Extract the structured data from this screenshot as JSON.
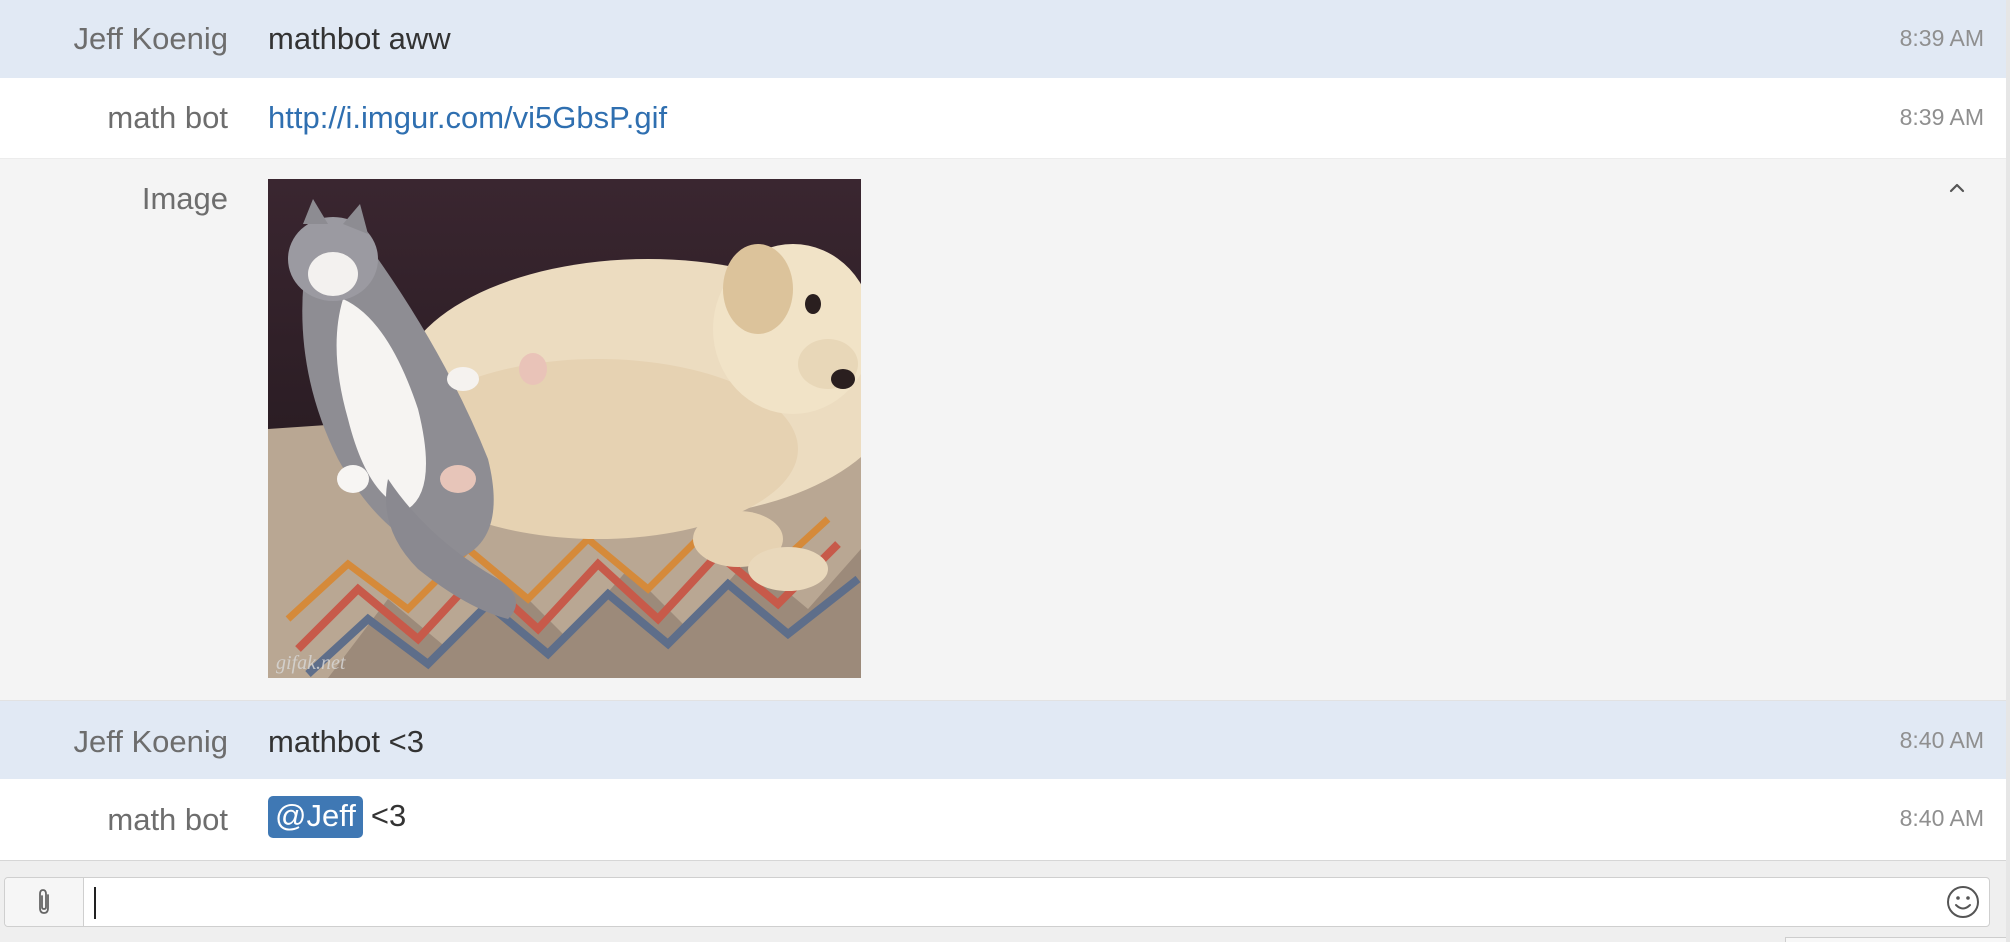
{
  "messages": [
    {
      "sender": "Jeff Koenig",
      "text": "mathbot aww",
      "time": "8:39 AM"
    },
    {
      "sender": "math bot",
      "link": "http://i.imgur.com/vi5GbsP.gif",
      "time": "8:39 AM"
    },
    {
      "sender": "Image",
      "watermark": "gifak.net"
    },
    {
      "sender": "Jeff Koenig",
      "text": "mathbot <3",
      "time": "8:40 AM"
    },
    {
      "sender": "math bot",
      "mention": "@Jeff",
      "text": "<3",
      "time": "8:40 AM"
    }
  ],
  "composer": {
    "value": "",
    "placeholder": ""
  },
  "icons": {
    "attach": "paperclip-icon",
    "emoji": "smiley-icon",
    "collapse": "chevron-up-icon"
  },
  "colors": {
    "self_row": "#e1e9f4",
    "image_row": "#f4f4f4",
    "link": "#2f6fb0",
    "mention": "#3f78b4"
  }
}
